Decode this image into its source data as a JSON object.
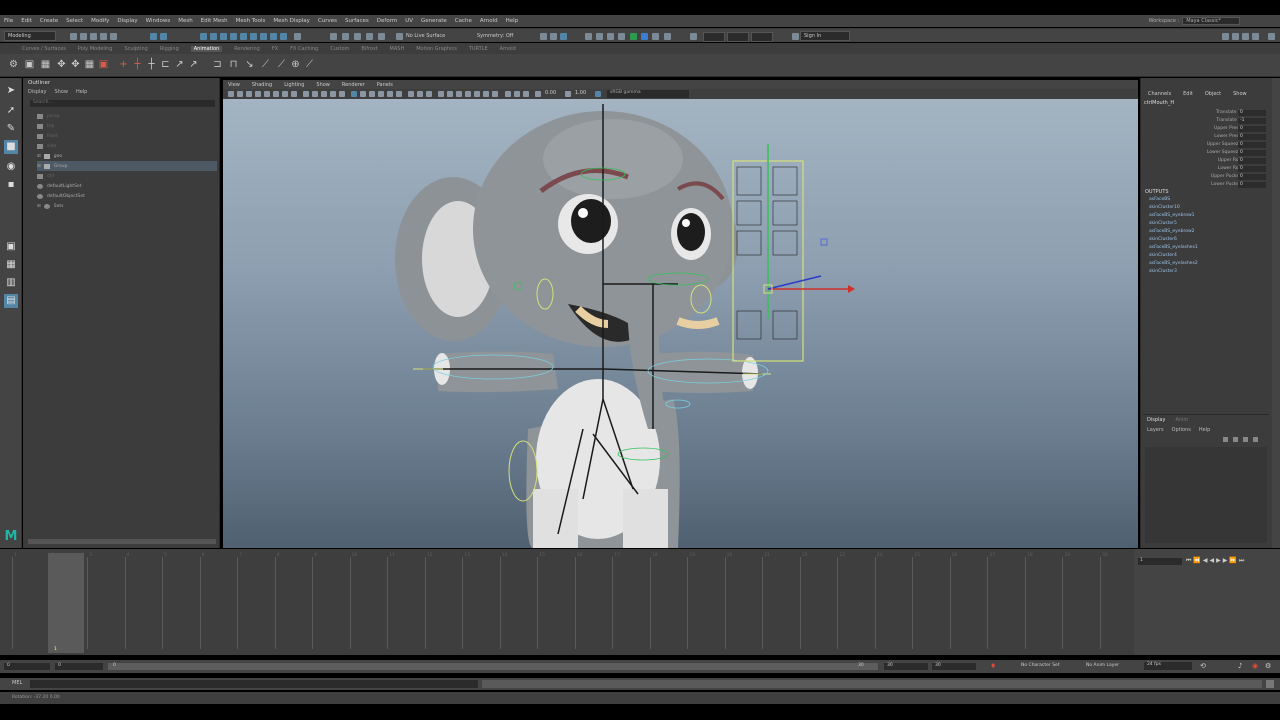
{
  "menubar": {
    "items": [
      "File",
      "Edit",
      "Create",
      "Select",
      "Modify",
      "Display",
      "Windows",
      "Mesh",
      "Edit Mesh",
      "Mesh Tools",
      "Mesh Display",
      "Curves",
      "Surfaces",
      "Deform",
      "UV",
      "Generate",
      "Cache",
      "Arnold",
      "Help"
    ],
    "workspace_label": "Workspace :",
    "workspace_value": "Maya Classic*"
  },
  "statusline": {
    "mode": "Modeling",
    "live_surface": "No Live Surface",
    "symmetry": "Symmetry: Off",
    "sign_in": "Sign In"
  },
  "shelf": {
    "tabs": [
      "Curves / Surfaces",
      "Poly Modeling",
      "Sculpting",
      "Rigging",
      "Animation",
      "Rendering",
      "FX",
      "FX Caching",
      "Custom",
      "Bifrost",
      "MASH",
      "Motion Graphics",
      "TURTLE",
      "Arnold"
    ],
    "active_tab": "Animation"
  },
  "outliner": {
    "title": "Outliner",
    "menu": [
      "Display",
      "Show",
      "Help"
    ],
    "search_placeholder": "Search...",
    "rows": [
      "persp",
      "top",
      "front",
      "side",
      "geo",
      "Group",
      "ctrl",
      "defaultLightSet",
      "defaultObjectSet",
      "Sets"
    ]
  },
  "viewport": {
    "menu": [
      "View",
      "Shading",
      "Lighting",
      "Show",
      "Renderer",
      "Panels"
    ],
    "exposure": "0.00",
    "gamma": "1.00",
    "color_space": "sRGB gamma"
  },
  "channelbox": {
    "tabs": [
      "Channels",
      "Edit",
      "Object",
      "Show"
    ],
    "object_name": "ctrlMouth_H",
    "attributes": [
      {
        "name": "Translate X",
        "value": "0"
      },
      {
        "name": "Translate Y",
        "value": "-1"
      },
      {
        "name": "Upper Press",
        "value": "0"
      },
      {
        "name": "Lower Press",
        "value": "0"
      },
      {
        "name": "Upper Squeeze",
        "value": "0"
      },
      {
        "name": "Lower Squeeze",
        "value": "0"
      },
      {
        "name": "Upper Roll",
        "value": "0"
      },
      {
        "name": "Lower Roll",
        "value": "0"
      },
      {
        "name": "Upper Pucker",
        "value": "0"
      },
      {
        "name": "Lower Pucker",
        "value": "0"
      }
    ],
    "outputs_label": "OUTPUTS",
    "outputs": [
      "asFaceBS",
      "skinCluster10",
      "asFaceBS_eyebrow1",
      "skinCluster5",
      "asFaceBS_eyebrow2",
      "skinCluster6",
      "asFaceBS_eyelashes1",
      "skinCluster4",
      "asFaceBS_eyelashes2",
      "skinCluster3"
    ]
  },
  "layers": {
    "tabs": [
      "Display",
      "Anim"
    ],
    "menu": [
      "Layers",
      "Options",
      "Help"
    ]
  },
  "timeline": {
    "current_frame": "1",
    "ticks": [
      "1",
      "2",
      "3",
      "4",
      "5",
      "6",
      "7",
      "8",
      "9",
      "10",
      "11",
      "12",
      "13",
      "14",
      "15",
      "16",
      "17",
      "18",
      "19",
      "20",
      "21",
      "22",
      "23",
      "24",
      "25",
      "26",
      "27",
      "28",
      "29",
      "30"
    ]
  },
  "rangebar": {
    "start": "0",
    "start2": "0",
    "range_start_label": "0",
    "range_end_label": "30",
    "end": "30",
    "end2": "30",
    "character_set": "No Character Set",
    "anim_layer": "No Anim Layer",
    "fps": "24 fps"
  },
  "cmdline": {
    "label": "MEL"
  },
  "helpline": {
    "text": "Rotation: -37.20  0.00"
  },
  "colors": {
    "accent": "#5285a6",
    "selection": "#4d5a66",
    "maya_logo": "#1fb6a5"
  }
}
